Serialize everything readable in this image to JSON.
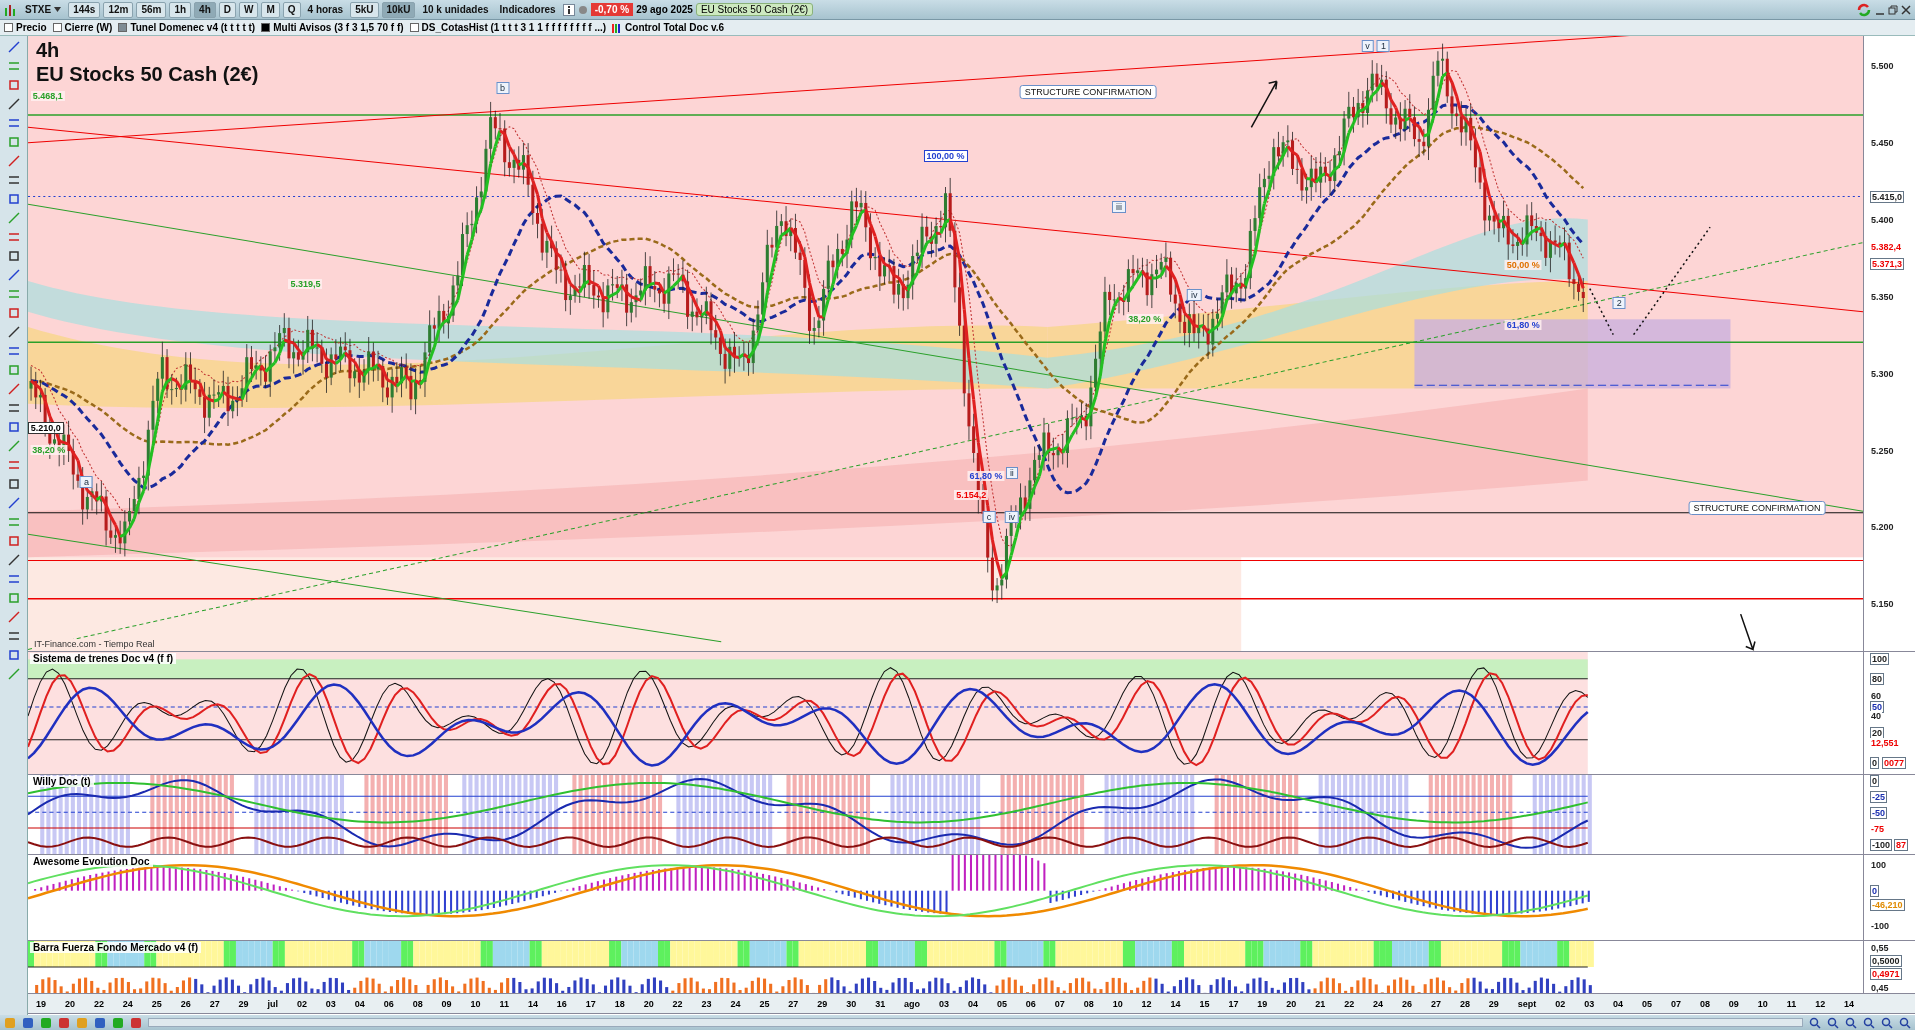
{
  "toolbar": {
    "symbol": "STXE",
    "timeframes": [
      {
        "label": "144s",
        "selected": false
      },
      {
        "label": "12m",
        "selected": false
      },
      {
        "label": "56m",
        "selected": false
      },
      {
        "label": "1h",
        "selected": false
      },
      {
        "label": "4h",
        "selected": true
      },
      {
        "label": "D",
        "selected": false
      },
      {
        "label": "W",
        "selected": false
      },
      {
        "label": "M",
        "selected": false
      },
      {
        "label": "Q",
        "selected": false
      }
    ],
    "period": "4 horas",
    "units": [
      {
        "label": "5kU",
        "selected": false
      },
      {
        "label": "10kU",
        "selected": true
      }
    ],
    "unit_select": "10 k unidades",
    "indicators": "Indicadores",
    "change": "-0,70 %",
    "date": "29 ago 2025",
    "instrument": "EU Stocks 50 Cash (2€)"
  },
  "legend": [
    {
      "label": "Precio",
      "kind": "check",
      "checked": false
    },
    {
      "label": "Cierre (W)",
      "kind": "check",
      "checked": false
    },
    {
      "label": "Tunel Domenec v4 (t t t t t)",
      "kind": "swatch",
      "color": "#7f8c94"
    },
    {
      "label": "Multi Avisos (3 f 3 1,5 70 f f)",
      "kind": "swatch",
      "color": "#000000"
    },
    {
      "label": "DS_CotasHist (1 t t t 3 1 1 f f f f f f f f ...)",
      "kind": "check",
      "checked": false
    },
    {
      "label": "Control Total Doc v.6",
      "kind": "bars"
    }
  ],
  "main_chart": {
    "timeframe": "4h",
    "title": "EU Stocks 50 Cash (2€)",
    "source": "IT-Finance.com - Tiempo Real",
    "annotations": [
      {
        "text": "5.468,1",
        "kind": "green"
      },
      {
        "text": "b",
        "kind": "wave"
      },
      {
        "text": "STRUCTURE CONFIRMATION",
        "kind": "callout"
      },
      {
        "text": "v",
        "kind": "wave"
      },
      {
        "text": "1",
        "kind": "wave"
      },
      {
        "text": "100,00 %",
        "kind": "fib"
      },
      {
        "text": "iii",
        "kind": "wave"
      },
      {
        "text": "5.319,5",
        "kind": "green"
      },
      {
        "text": "50,00 %",
        "kind": "orange"
      },
      {
        "text": "iv",
        "kind": "wave"
      },
      {
        "text": "2",
        "kind": "wave"
      },
      {
        "text": "38,20 %",
        "kind": "green"
      },
      {
        "text": "61,80 %",
        "kind": "blue"
      },
      {
        "text": "5.210,0",
        "kind": "price"
      },
      {
        "text": "38,20 %",
        "kind": "green"
      },
      {
        "text": "a",
        "kind": "wave"
      },
      {
        "text": "61,80 %",
        "kind": "blue"
      },
      {
        "text": "ii",
        "kind": "wave"
      },
      {
        "text": "5.154,2",
        "kind": "red"
      },
      {
        "text": "c",
        "kind": "wave"
      },
      {
        "text": "iv",
        "kind": "wave"
      },
      {
        "text": "STRUCTURE CONFIRMATION",
        "kind": "callout"
      }
    ],
    "axis_labels": [
      {
        "text": "5.500",
        "kind": "tick"
      },
      {
        "text": "5.450",
        "kind": "tick"
      },
      {
        "text": "5.415,0",
        "kind": "marker"
      },
      {
        "text": "5.400",
        "kind": "tick"
      },
      {
        "text": "5.382,4",
        "kind": "red"
      },
      {
        "text": "5.371,3",
        "kind": "marker-red"
      },
      {
        "text": "5.350",
        "kind": "tick"
      },
      {
        "text": "5.300",
        "kind": "tick"
      },
      {
        "text": "5.250",
        "kind": "tick"
      },
      {
        "text": "5.200",
        "kind": "tick"
      },
      {
        "text": "5.150",
        "kind": "tick"
      }
    ]
  },
  "panels": [
    {
      "title": "Sistema de trenes Doc v4 (f f)",
      "axis_labels": [
        {
          "text": "100",
          "kind": "marker"
        },
        {
          "text": "80",
          "kind": "marker"
        },
        {
          "text": "60",
          "kind": "tick"
        },
        {
          "text": "50",
          "kind": "marker-blue"
        },
        {
          "text": "40",
          "kind": "tick"
        },
        {
          "text": "20",
          "kind": "marker"
        },
        {
          "text": "12,551",
          "kind": "red"
        },
        {
          "text": "0",
          "kind": "marker"
        },
        {
          "text": "0077",
          "kind": "marker-red"
        }
      ]
    },
    {
      "title": "Willy Doc (t)",
      "axis_labels": [
        {
          "text": "0",
          "kind": "marker"
        },
        {
          "text": "-25",
          "kind": "marker-blue"
        },
        {
          "text": "-50",
          "kind": "marker-blue"
        },
        {
          "text": "-75",
          "kind": "red"
        },
        {
          "text": "-100",
          "kind": "marker"
        },
        {
          "text": "87",
          "kind": "marker-red"
        }
      ]
    },
    {
      "title": "Awesome Evolution Doc",
      "axis_labels": [
        {
          "text": "100",
          "kind": "tick"
        },
        {
          "text": "0",
          "kind": "marker-blue"
        },
        {
          "text": "-46,210",
          "kind": "marker-orange"
        },
        {
          "text": "-100",
          "kind": "tick"
        }
      ]
    },
    {
      "title": "Barra Fuerza Fondo Mercado v4 (f)",
      "axis_labels": [
        {
          "text": "0,55",
          "kind": "tick"
        },
        {
          "text": "0,5000",
          "kind": "marker"
        },
        {
          "text": "0,4971",
          "kind": "marker-red"
        },
        {
          "text": "0,45",
          "kind": "tick"
        }
      ]
    }
  ],
  "date_axis": [
    "19",
    "20",
    "22",
    "24",
    "25",
    "26",
    "27",
    "29",
    "jul",
    "02",
    "03",
    "04",
    "06",
    "08",
    "09",
    "10",
    "11",
    "14",
    "16",
    "17",
    "18",
    "20",
    "22",
    "23",
    "24",
    "25",
    "27",
    "29",
    "30",
    "31",
    "ago",
    "03",
    "04",
    "05",
    "06",
    "07",
    "08",
    "10",
    "12",
    "14",
    "15",
    "17",
    "19",
    "20",
    "21",
    "22",
    "24",
    "26",
    "27",
    "28",
    "29",
    "sept",
    "02",
    "03",
    "04",
    "05",
    "07",
    "08",
    "09",
    "10",
    "11",
    "12",
    "14"
  ]
}
